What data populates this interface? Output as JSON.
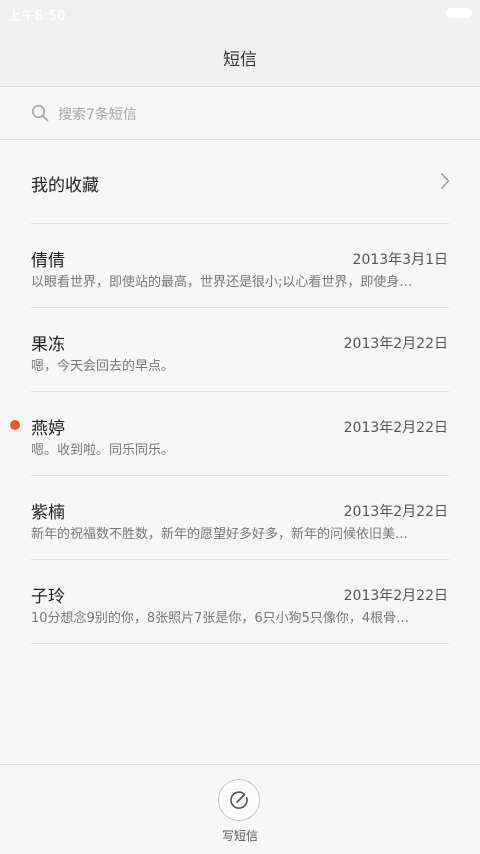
{
  "status_bar": {
    "time": "上午8:50",
    "battery_icon": "battery-icon"
  },
  "header": {
    "title": "短信"
  },
  "search": {
    "icon": "search-icon",
    "placeholder": "搜索7条短信"
  },
  "favorites": {
    "label": "我的收藏",
    "icon": "chevron-right-icon"
  },
  "messages": [
    {
      "name": "倩倩",
      "date": "2013年3月1日",
      "preview": "以眼看世界，即使站的最高，世界还是很小;以心看世界，即使身…",
      "unread": false
    },
    {
      "name": "果冻",
      "date": "2013年2月22日",
      "preview": "嗯，今天会回去的早点。",
      "unread": false
    },
    {
      "name": "燕婷",
      "date": "2013年2月22日",
      "preview": "嗯。收到啦。同乐同乐。",
      "unread": true
    },
    {
      "name": "紫楠",
      "date": "2013年2月22日",
      "preview": "新年的祝福数不胜数，新年的愿望好多好多，新年的问候依旧美…",
      "unread": false
    },
    {
      "name": "子玲",
      "date": "2013年2月22日",
      "preview": "10分想念9别的你，8张照片7张是你，6只小狗5只像你，4根骨…",
      "unread": false
    }
  ],
  "compose": {
    "label": "写短信",
    "icon": "compose-icon"
  },
  "colors": {
    "unread_dot": "#f05a22",
    "status_bar_text": "#ffffff"
  }
}
